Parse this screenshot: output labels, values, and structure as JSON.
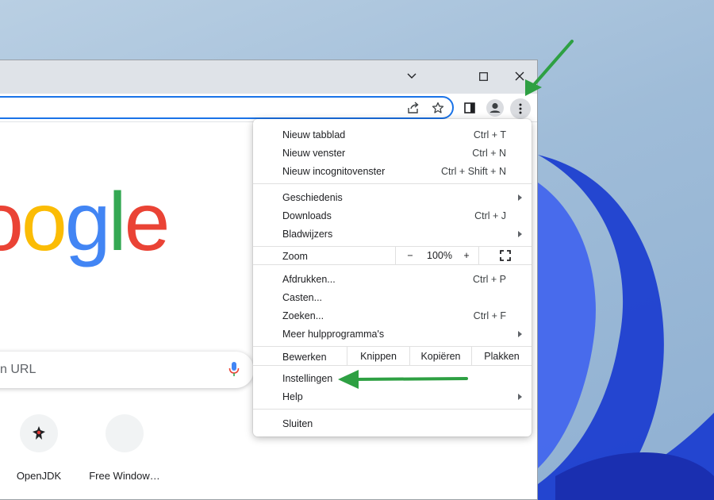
{
  "browser": {
    "controls": {
      "minimize_icon": "chevron-down-icon",
      "restore_icon": "square-icon",
      "close_icon": "close-icon"
    },
    "toolbar_icons": [
      "share-icon",
      "star-icon",
      "side-panel-icon",
      "profile-icon",
      "menu-dots-icon"
    ]
  },
  "page": {
    "logo_text": "oogle",
    "search_placeholder": "n URL",
    "shortcuts": [
      {
        "label": "OpenJDK",
        "icon": "openjdk-icon"
      },
      {
        "label": "Free Window…",
        "icon": "blank-icon"
      }
    ]
  },
  "menu": {
    "group1": [
      {
        "label": "Nieuw tabblad",
        "shortcut": "Ctrl + T"
      },
      {
        "label": "Nieuw venster",
        "shortcut": "Ctrl + N"
      },
      {
        "label": "Nieuw incognitovenster",
        "shortcut": "Ctrl + Shift + N"
      }
    ],
    "group2": [
      {
        "label": "Geschiedenis",
        "shortcut": ""
      },
      {
        "label": "Downloads",
        "shortcut": "Ctrl + J"
      },
      {
        "label": "Bladwijzers",
        "shortcut": ""
      }
    ],
    "zoom": {
      "label": "Zoom",
      "minus": "−",
      "value": "100%",
      "plus": "+"
    },
    "group3": [
      {
        "label": "Afdrukken...",
        "shortcut": "Ctrl + P"
      },
      {
        "label": "Casten...",
        "shortcut": ""
      },
      {
        "label": "Zoeken...",
        "shortcut": "Ctrl + F"
      },
      {
        "label": "Meer hulpprogramma's",
        "shortcut": ""
      }
    ],
    "edit": {
      "label": "Bewerken",
      "cut": "Knippen",
      "copy": "Kopiëren",
      "paste": "Plakken"
    },
    "group4": [
      {
        "label": "Instellingen"
      },
      {
        "label": "Help"
      }
    ],
    "exit": "Sluiten"
  },
  "colors": {
    "accent": "#1a73e8",
    "annotation_arrow": "#2ea043",
    "google_blue": "#4285f4",
    "google_red": "#ea4335",
    "google_yellow": "#fbbc05",
    "google_green": "#34a853"
  }
}
